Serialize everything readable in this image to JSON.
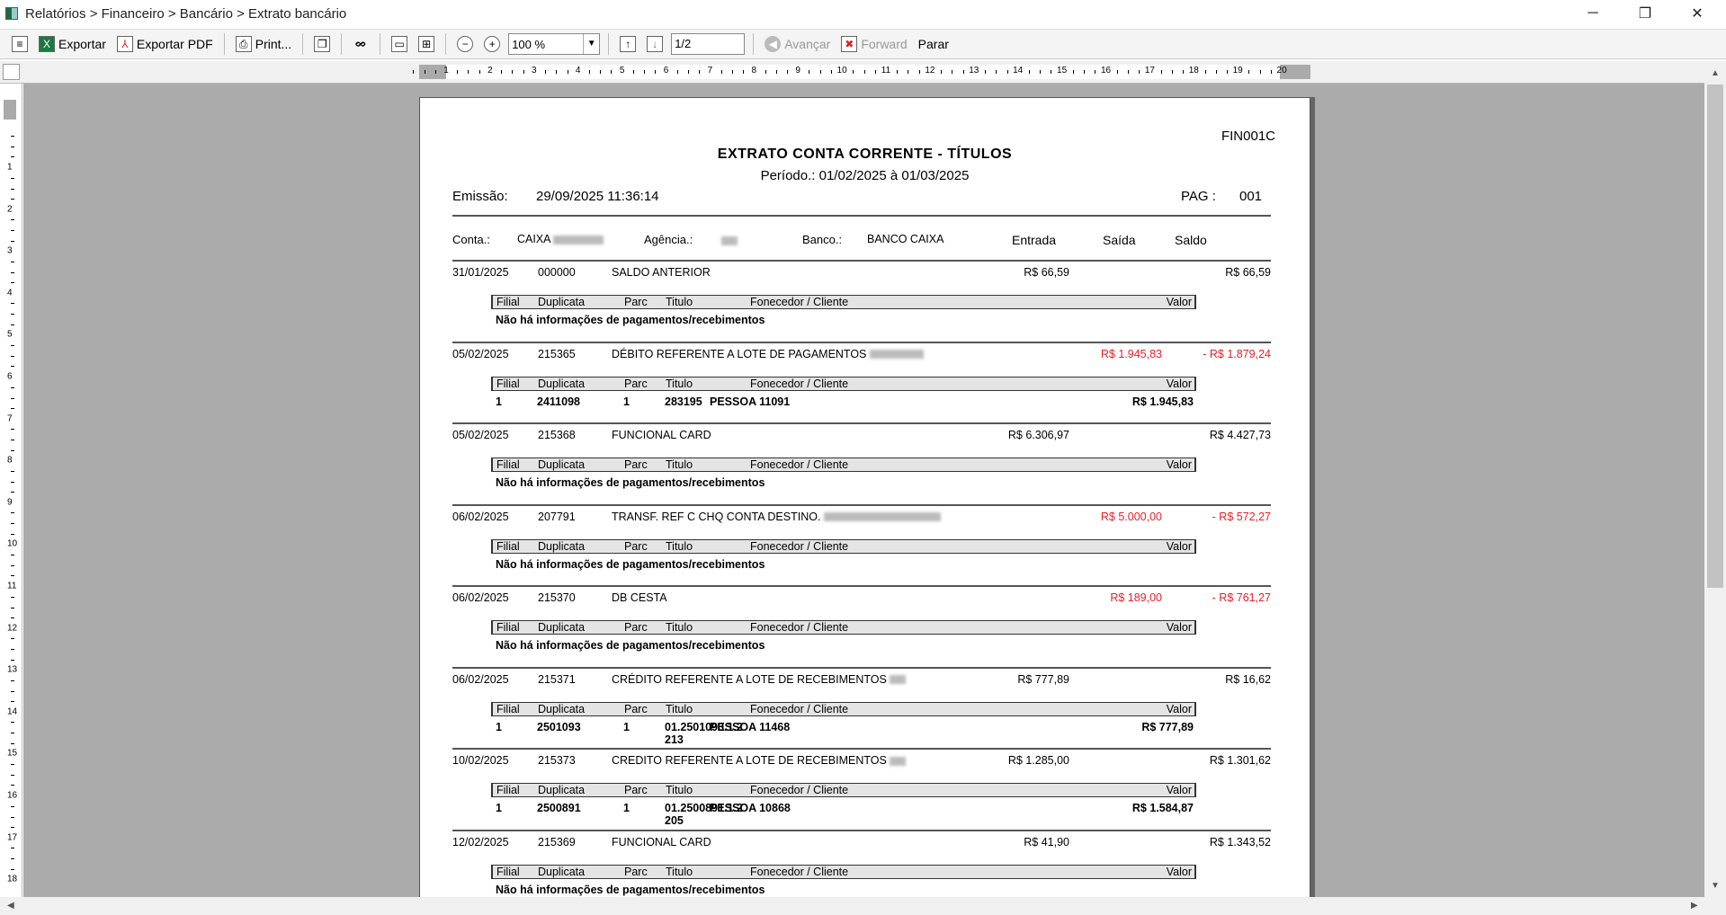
{
  "window": {
    "title": "Relatórios > Financeiro > Bancário > Extrato bancário",
    "min": "─",
    "max": "❐",
    "close": "✕"
  },
  "toolbar": {
    "export": "Exportar",
    "export_pdf": "Exportar PDF",
    "print": "Print...",
    "zoom": "100 %",
    "page": "1/2",
    "avancar": "Avançar",
    "forward": "Forward",
    "parar": "Parar"
  },
  "ruler": {
    "h": [
      "1",
      "2",
      "3",
      "4",
      "5",
      "6",
      "7",
      "8",
      "9",
      "10",
      "11",
      "12",
      "13",
      "14",
      "15",
      "16",
      "17",
      "18",
      "19",
      "20"
    ],
    "v": [
      "1",
      "2",
      "3",
      "4",
      "5",
      "6",
      "7",
      "8",
      "9",
      "10",
      "11",
      "12",
      "13",
      "14",
      "15",
      "16",
      "17",
      "18"
    ]
  },
  "report": {
    "code": "FIN001C",
    "title": "EXTRATO CONTA CORRENTE - TÍTULOS",
    "periodo": "Período.: 01/02/2025  à 01/03/2025",
    "emissao_label": "Emissão:",
    "emissao": "29/09/2025 11:36:14",
    "pag_label": "PAG :",
    "pag": "001",
    "header": {
      "conta_label": "Conta.:",
      "conta": "CAIXA",
      "agencia_label": "Agência.:",
      "banco_label": "Banco.:",
      "banco": "BANCO CAIXA",
      "entrada": "Entrada",
      "saida": "Saída",
      "saldo": "Saldo"
    },
    "sub_cols": {
      "filial": "Filial",
      "duplicata": "Duplicata",
      "parc": "Parc",
      "titulo": "Titulo",
      "fornecedor": "Fonecedor / Cliente",
      "valor": "Valor"
    },
    "no_info": "Não há informações de pagamentos/recebimentos",
    "entries": [
      {
        "date": "31/01/2025",
        "doc": "000000",
        "desc": "SALDO ANTERIOR",
        "blur": 0,
        "entrada": "R$ 66,59",
        "saida": "",
        "saldo": "R$ 66,59",
        "neg": false,
        "detail": null
      },
      {
        "date": "05/02/2025",
        "doc": "215365",
        "desc": "DÉBITO REFERENTE A LOTE DE PAGAMENTOS",
        "blur": 60,
        "entrada": "",
        "saida": "R$ 1.945,83",
        "saldo": "- R$ 1.879,24",
        "neg": true,
        "detail": {
          "filial": "1",
          "duplicata": "2411098",
          "parc": "1",
          "titulo": "283195",
          "fornecedor": "PESSOA 11091",
          "titulo2": "",
          "valor": "R$ 1.945,83"
        }
      },
      {
        "date": "05/02/2025",
        "doc": "215368",
        "desc": "FUNCIONAL CARD",
        "blur": 0,
        "entrada": "R$ 6.306,97",
        "saida": "",
        "saldo": "R$ 4.427,73",
        "neg": false,
        "detail": null
      },
      {
        "date": "06/02/2025",
        "doc": "207791",
        "desc": "TRANSF. REF C  CHQ CONTA DESTINO.",
        "blur": 130,
        "entrada": "",
        "saida": "R$ 5.000,00",
        "saldo": "- R$ 572,27",
        "neg": true,
        "detail": null
      },
      {
        "date": "06/02/2025",
        "doc": "215370",
        "desc": "DB CESTA",
        "blur": 0,
        "entrada": "",
        "saida": "R$ 189,00",
        "saldo": "- R$ 761,27",
        "neg": true,
        "detail": null
      },
      {
        "date": "06/02/2025",
        "doc": "215371",
        "desc": "CRÉDITO REFERENTE A LOTE DE RECEBIMENTOS",
        "blur": 18,
        "entrada": "R$ 777,89",
        "saida": "",
        "saldo": "R$ 16,62",
        "neg": false,
        "detail": {
          "filial": "1",
          "duplicata": "2501093",
          "parc": "1",
          "titulo": "01.2501093.1.2",
          "fornecedor": "PESSOA 11468",
          "titulo2": "213",
          "valor": "R$ 777,89"
        }
      },
      {
        "date": "10/02/2025",
        "doc": "215373",
        "desc": "CREDITO REFERENTE A LOTE DE RECEBIMENTOS",
        "blur": 18,
        "entrada": "R$ 1.285,00",
        "saida": "",
        "saldo": "R$ 1.301,62",
        "neg": false,
        "detail": {
          "filial": "1",
          "duplicata": "2500891",
          "parc": "1",
          "titulo": "01.2500891.1.2",
          "fornecedor": "PESSOA 10868",
          "titulo2": "205",
          "valor": "R$ 1.584,87"
        }
      },
      {
        "date": "12/02/2025",
        "doc": "215369",
        "desc": "FUNCIONAL CARD",
        "blur": 0,
        "entrada": "R$ 41,90",
        "saida": "",
        "saldo": "R$ 1.343,52",
        "neg": false,
        "detail": null
      }
    ]
  },
  "colors": {
    "negative": "#e8202a",
    "canvas": "#ababab"
  }
}
